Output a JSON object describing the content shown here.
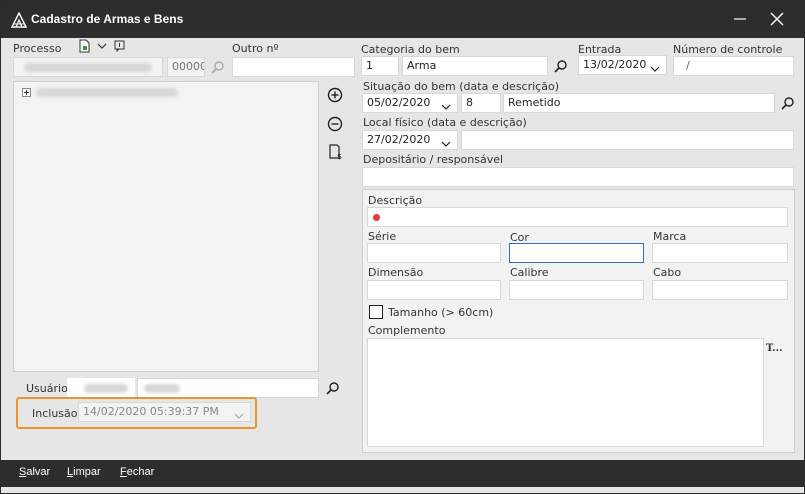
{
  "window": {
    "title": "Cadastro de Armas e Bens"
  },
  "left": {
    "processo_label": "Processo",
    "processo_number": "00000",
    "outro_label": "Outro nº",
    "outro_value": "",
    "usuario_label": "Usuário",
    "inclusao_label": "Inclusão",
    "inclusao_value": "14/02/2020 05:39:37 PM"
  },
  "right": {
    "categoria_label": "Categoria do bem",
    "categoria_code": "1",
    "categoria_name": "Arma",
    "entrada_label": "Entrada",
    "entrada_value": "13/02/2020",
    "controle_label": "Número de controle",
    "controle_value": "/",
    "situacao_label": "Situação do bem (data e descrição)",
    "situacao_date": "05/02/2020",
    "situacao_code": "8",
    "situacao_desc": "Remetido",
    "local_label": "Local físico (data e descrição)",
    "local_date": "27/02/2020",
    "local_desc": "",
    "depositario_label": "Depositário / responsável",
    "depositario_value": ""
  },
  "details": {
    "descricao_label": "Descrição",
    "serie_label": "Série",
    "cor_label": "Cor",
    "marca_label": "Marca",
    "dimensao_label": "Dimensão",
    "calibre_label": "Calibre",
    "cabo_label": "Cabo",
    "tamanho_label": "Tamanho (> 60cm)",
    "complemento_label": "Complemento",
    "text_tool_label": "T..."
  },
  "footer": {
    "salvar_first": "S",
    "salvar_rest": "alvar",
    "limpar_first": "L",
    "limpar_rest": "impar",
    "fechar_first": "F",
    "fechar_rest": "echar"
  },
  "colors": {
    "titlebar": "#2d2d2d",
    "highlight": "#e89530",
    "focus": "#2f6fbf",
    "required_dot": "#e53935"
  }
}
